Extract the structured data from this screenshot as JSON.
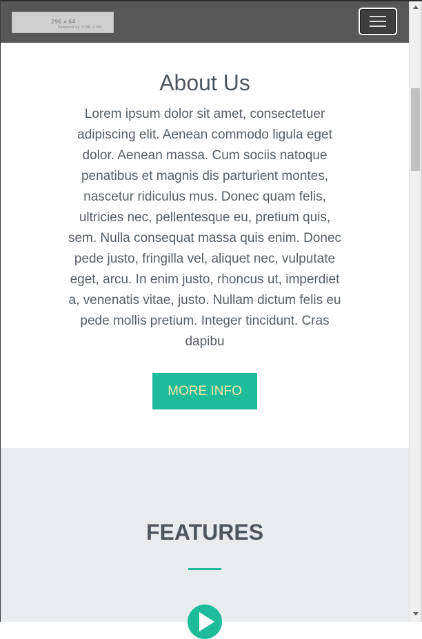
{
  "navbar": {
    "logo_text": "296 x 64",
    "logo_subtext": "Powered by HTML.COM"
  },
  "about": {
    "title": "About Us",
    "body": "Lorem ipsum dolor sit amet, consectetuer adipiscing elit. Aenean commodo ligula eget dolor. Aenean massa. Cum sociis natoque penatibus et magnis dis parturient montes, nascetur ridiculus mus. Donec quam felis, ultricies nec, pellentesque eu, pretium quis, sem. Nulla consequat massa quis enim. Donec pede justo, fringilla vel, aliquet nec, vulputate eget, arcu. In enim justo, rhoncus ut, imperdiet a, venenatis vitae, justo. Nullam dictum felis eu pede mollis pretium. Integer tincidunt. Cras dapibu",
    "button_label": "MORE INFO"
  },
  "features": {
    "title": "FEATURES",
    "icon": "play-circle-icon"
  },
  "colors": {
    "navbar_bg": "#575757",
    "accent": "#1fbc9c",
    "button_text": "#f3e2a6",
    "heading_text": "#4d565e",
    "features_bg": "#e8ecef"
  }
}
